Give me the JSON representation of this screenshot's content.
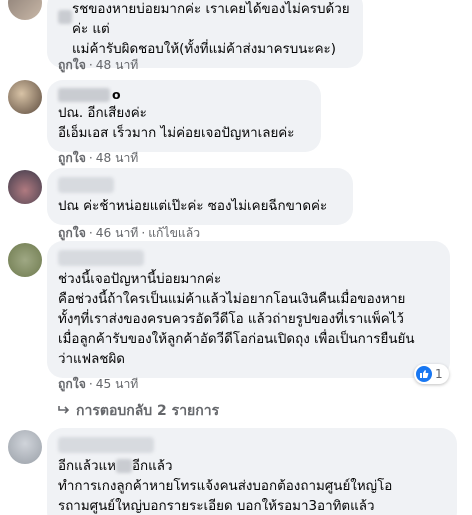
{
  "comments": [
    {
      "text": "รชของหายบ่อยมากค่ะ เราเคยได้ของไม่ครบด้วยค่ะ แต่\nแม่ค้ารับผิดชอบให้(ทั้งที่แม่ค้าส่งมาครบนะคะ)",
      "like_label": "ถูกใจ",
      "time": "48 นาที",
      "avatar_colors": [
        "#8a7d74",
        "#c9b8a8"
      ]
    },
    {
      "author_suffix": "o",
      "text": "ปณ. อีกเสียงค่ะ\nอีเอ็มเอส เร็วมาก ไม่ค่อยเจอปัญหาเลยค่ะ",
      "like_label": "ถูกใจ",
      "time": "48 นาที",
      "avatar_colors": [
        "#5b4a3d",
        "#d8c3a6"
      ]
    },
    {
      "text": "ปณ ค่ะช้าหน่อยแต่เป๊ะค่ะ ซองไม่เคยฉีกขาดค่ะ",
      "like_label": "ถูกใจ",
      "time": "46 นาที",
      "edited": "แก้ไขแล้ว",
      "avatar_colors": [
        "#3d3a4a",
        "#b07a80"
      ]
    },
    {
      "text": "ช่วงนี้เจอปัญหานี้บ่อยมากค่ะ\nคือช่วงนี้ถ้าใครเป็นแม่ค้าแล้วไม่อยากโอนเงินคืนเมื่อของหาย\nทั้งๆที่เราส่งของครบควรอัดวีดีโอ แล้วถ่ายรูปของที่เราแพ็คไว้\nเมื่อลูกค้ารับของให้ลูกค้าอัดวีดีโอก่อนเปิดถุง เพื่อเป็นการยืนยัน\nว่าแฟลชผิด",
      "like_label": "ถูกใจ",
      "time": "45 นาที",
      "reaction_count": "1",
      "avatar_colors": [
        "#6e7a4e",
        "#9fa884"
      ]
    },
    {
      "text_line1_a": "อีกแล้วแห",
      "text_line1_b": "อีกแล้ว",
      "text_rest": "ทำการเกงลูกค้าหายโทรแจ้งคนส่งบอกต้องถามศูนย์ใหญ่โอ\nรถามศูนย์ใหญ่บอกรายระเอียด บอกให้รอมา3อาทิตแล้ว",
      "avatar_colors": [
        "#9aa0a8",
        "#d0d4da"
      ]
    }
  ],
  "replies_link": "การตอบกลับ 2 รายการ",
  "colors": {
    "bubble": "#f0f2f5",
    "meta": "#65676b",
    "like_blue": "#1877f2"
  }
}
